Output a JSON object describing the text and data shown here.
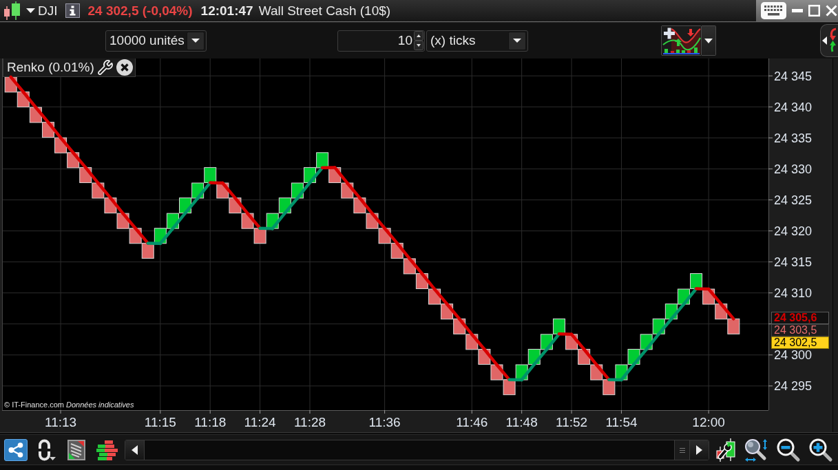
{
  "window": {
    "symbol": "DJI",
    "quote": "24 302,5 (-0,04%)",
    "time": "12:01:47",
    "instrument": "Wall Street Cash (10$)"
  },
  "toolbar": {
    "quantity_select": {
      "value": "10000 unités"
    },
    "interval_field": {
      "value": "10"
    },
    "interval_unit_select": {
      "value": "(x) ticks"
    }
  },
  "chart": {
    "indicator": "Renko (0.01%)",
    "source_note": "© IT-Finance.com *Données indicatives*",
    "price_tags": [
      {
        "text": "24 305,6",
        "kind": "last"
      },
      {
        "text": "24 303,5",
        "kind": "reference"
      },
      {
        "text": "24 302,5",
        "kind": "current"
      }
    ],
    "chart_data": {
      "type": "scatter",
      "grid": true,
      "categories": [
        null,
        null,
        null,
        null,
        "11:13",
        null,
        null,
        null,
        null,
        null,
        null,
        null,
        "11:15",
        null,
        null,
        null,
        "11:18",
        null,
        null,
        null,
        "11:24",
        null,
        null,
        null,
        "11:28",
        null,
        null,
        null,
        null,
        null,
        "11:36",
        null,
        null,
        null,
        null,
        null,
        null,
        "11:46",
        null,
        null,
        null,
        "11:48",
        null,
        null,
        null,
        "11:52",
        null,
        null,
        null,
        "11:54",
        null,
        null,
        null,
        null,
        null,
        null,
        "12:00",
        null,
        null
      ],
      "series": [
        {
          "color": "#00cc33",
          "values": [
            null,
            null,
            null,
            null,
            null,
            null,
            null,
            null,
            null,
            null,
            null,
            null,
            24319.2,
            24321.6,
            24324.1,
            24326.5,
            24329.0,
            null,
            null,
            null,
            null,
            24321.6,
            24324.1,
            24326.5,
            24329.0,
            24331.4,
            null,
            null,
            null,
            null,
            null,
            null,
            null,
            null,
            null,
            null,
            null,
            null,
            null,
            null,
            null,
            24297.2,
            24299.7,
            24302.1,
            24304.6,
            null,
            null,
            null,
            null,
            24297.2,
            24299.7,
            24302.1,
            24304.6,
            24307.0,
            24309.4,
            24311.9,
            null,
            null,
            null
          ]
        },
        {
          "color": "#e06666",
          "values": [
            24343.6,
            24341.2,
            24338.7,
            24336.3,
            24333.8,
            24331.4,
            24329.0,
            24326.5,
            24324.1,
            24321.6,
            24319.2,
            24316.8,
            null,
            null,
            null,
            null,
            null,
            24326.5,
            24324.1,
            24321.6,
            24319.2,
            null,
            null,
            null,
            null,
            null,
            24329.0,
            24326.5,
            24324.1,
            24321.6,
            24319.2,
            24316.8,
            24314.3,
            24311.9,
            24309.4,
            24307.0,
            24304.6,
            24302.1,
            24299.7,
            24297.2,
            24294.8,
            null,
            null,
            null,
            null,
            24302.1,
            24299.7,
            24297.2,
            24294.8,
            null,
            null,
            null,
            null,
            null,
            null,
            null,
            24309.4,
            24307.0,
            24304.6
          ]
        }
      ],
      "ylim": [
        24291.1,
        24347.8
      ],
      "yticks": [
        {
          "value": 24295,
          "label": "24 295"
        },
        {
          "value": 24300,
          "label": "24 300"
        },
        {
          "value": 24310,
          "label": "24 310"
        },
        {
          "value": 24315,
          "label": "24 315"
        },
        {
          "value": 24320,
          "label": "24 320"
        },
        {
          "value": 24325,
          "label": "24 325"
        },
        {
          "value": 24330,
          "label": "24 330"
        },
        {
          "value": 24335,
          "label": "24 335"
        },
        {
          "value": 24340,
          "label": "24 340"
        },
        {
          "value": 24345,
          "label": "24 345"
        }
      ]
    }
  },
  "bottom_toolbar": {
    "buttons": [
      {
        "kind": "share",
        "selected": true
      },
      {
        "kind": "link",
        "selected": false
      },
      {
        "kind": "document",
        "selected": false
      },
      {
        "kind": "bricks",
        "selected": false
      }
    ]
  }
}
